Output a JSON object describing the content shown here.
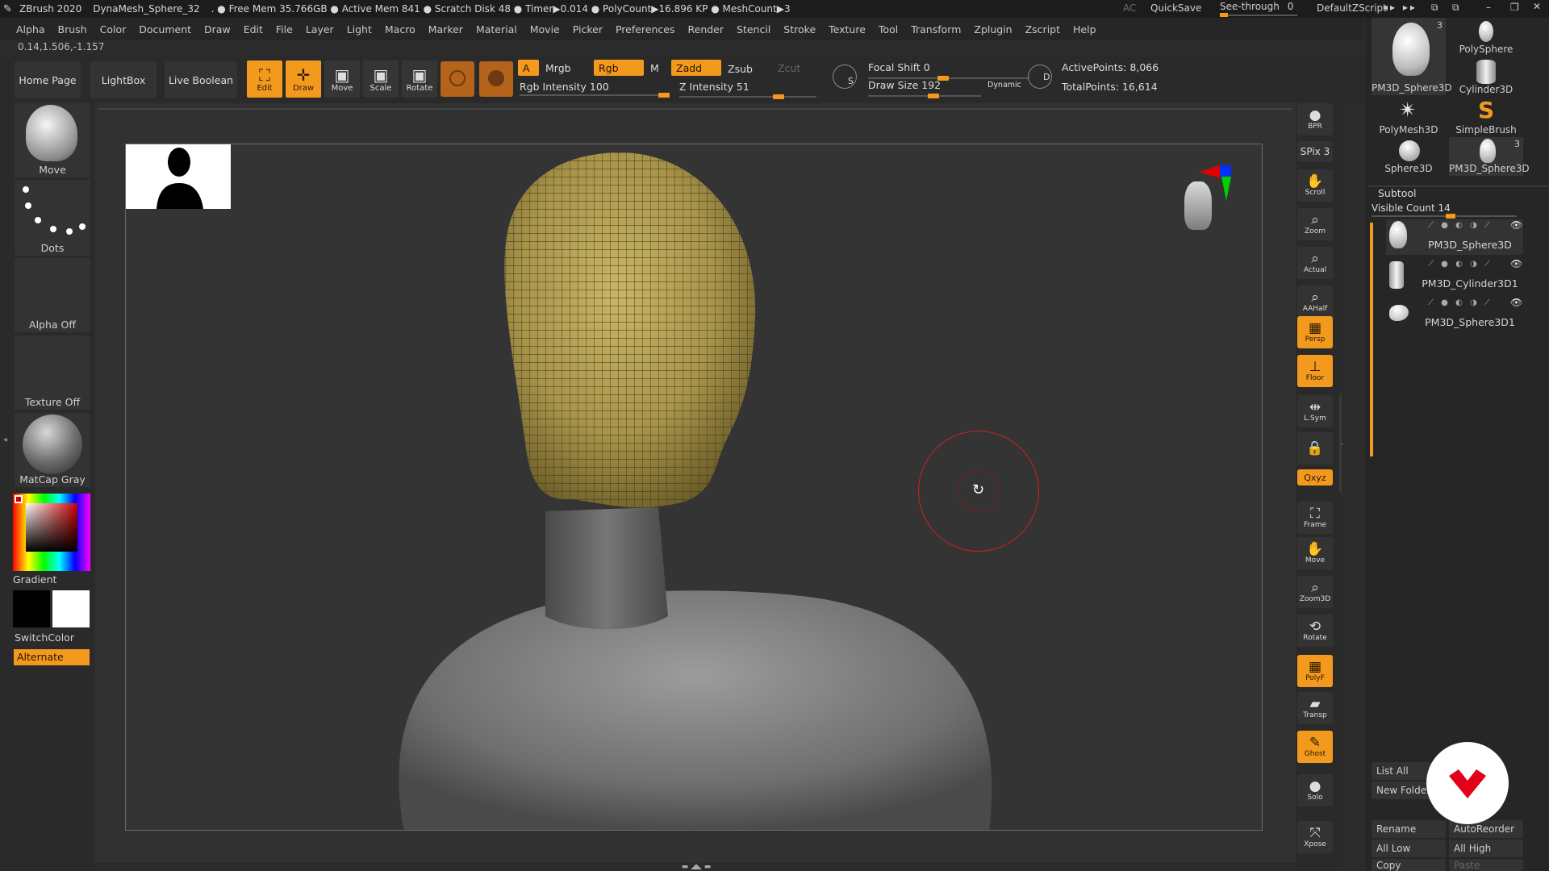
{
  "titlebar": {
    "app": "ZBrush 2020",
    "project": "DynaMesh_Sphere_32",
    "stats": ". ● Free Mem 35.766GB ● Active Mem 841 ● Scratch Disk 48 ● Timer▶0.014 ● PolyCount▶16.896 KP ● MeshCount▶3",
    "ac": "AC",
    "quicksave": "QuickSave",
    "seethrough": "See-through",
    "seethrough_value": "0",
    "script": "DefaultZScript"
  },
  "menu": [
    "Alpha",
    "Brush",
    "Color",
    "Document",
    "Draw",
    "Edit",
    "File",
    "Layer",
    "Light",
    "Macro",
    "Marker",
    "Material",
    "Movie",
    "Picker",
    "Preferences",
    "Render",
    "Stencil",
    "Stroke",
    "Texture",
    "Tool",
    "Transform",
    "Zplugin",
    "Zscript",
    "Help"
  ],
  "coords": "0.14,1.506,-1.157",
  "toptray": {
    "home": "Home Page",
    "lightbox": "LightBox",
    "liveboolean": "Live Boolean",
    "tools": [
      {
        "label": "Edit",
        "icon": "edit-icon",
        "active": true
      },
      {
        "label": "Draw",
        "icon": "draw-icon",
        "active": true
      },
      {
        "label": "Move",
        "icon": "move-icon",
        "active": false
      },
      {
        "label": "Scale",
        "icon": "scale-icon",
        "active": false
      },
      {
        "label": "Rotate",
        "icon": "rotate-icon",
        "active": false
      }
    ],
    "a": "A",
    "mrgb": "Mrgb",
    "rgb": "Rgb",
    "m": "M",
    "zadd": "Zadd",
    "zsub": "Zsub",
    "zcut": "Zcut",
    "rgb_intensity": "Rgb Intensity 100",
    "z_intensity": "Z Intensity 51",
    "focal_shift": "Focal Shift 0",
    "draw_size": "Draw Size 192",
    "dynamic": "Dynamic",
    "s": "S",
    "d": "D",
    "active_points": "ActivePoints: 8,066",
    "total_points": "TotalPoints: 16,614"
  },
  "leftshelf": {
    "brush": "Move",
    "stroke": "Dots",
    "alpha": "Alpha Off",
    "texture": "Texture Off",
    "material": "MatCap Gray",
    "gradient": "Gradient",
    "switchcolor": "SwitchColor",
    "alternate": "Alternate"
  },
  "rightshelf": [
    {
      "label": "BPR",
      "icon": "bpr-icon",
      "on": false
    },
    {
      "label": "SPix 3",
      "icon": "spix-icon",
      "on": false
    },
    {
      "label": "Scroll",
      "icon": "scroll-icon",
      "on": false
    },
    {
      "label": "Zoom",
      "icon": "zoom-icon",
      "on": false
    },
    {
      "label": "Actual",
      "icon": "actual-icon",
      "on": false
    },
    {
      "label": "AAHalf",
      "icon": "aahalf-icon",
      "on": false
    },
    {
      "label": "Persp",
      "icon": "persp-icon",
      "on": true
    },
    {
      "label": "Floor",
      "icon": "floor-icon",
      "on": true
    },
    {
      "label": "L.Sym",
      "icon": "lsym-icon",
      "on": false
    },
    {
      "label": "",
      "icon": "lock-icon",
      "on": false
    },
    {
      "label": "Qxyz",
      "icon": "xyz-icon",
      "on": true
    },
    {
      "label": "Frame",
      "icon": "frame-icon",
      "on": false
    },
    {
      "label": "Move",
      "icon": "move-icon",
      "on": false
    },
    {
      "label": "Zoom3D",
      "icon": "zoom3d-icon",
      "on": false
    },
    {
      "label": "Rotate",
      "icon": "rotate-icon",
      "on": false
    },
    {
      "label": "PolyF",
      "icon": "polyf-icon",
      "on": true
    },
    {
      "label": "Transp",
      "icon": "transp-icon",
      "on": false
    },
    {
      "label": "Ghost",
      "icon": "ghost-icon",
      "on": true
    },
    {
      "label": "Solo",
      "icon": "solo-icon",
      "on": false
    },
    {
      "label": "Xpose",
      "icon": "xpose-icon",
      "on": false
    }
  ],
  "rpanel": {
    "tools": [
      {
        "name": "PM3D_Sphere3D",
        "badge": "3"
      },
      {
        "name": "PolySphere",
        "badge": ""
      },
      {
        "name": "Cylinder3D",
        "badge": ""
      },
      {
        "name": "PolyMesh3D",
        "badge": ""
      },
      {
        "name": "SimpleBrush",
        "badge": ""
      },
      {
        "name": "Sphere3D",
        "badge": ""
      },
      {
        "name": "PM3D_Sphere3D",
        "badge": "3"
      }
    ],
    "subtool_title": "Subtool",
    "visible_count": "Visible Count 14",
    "subtools": [
      "PM3D_Sphere3D",
      "PM3D_Cylinder3D1",
      "PM3D_Sphere3D1"
    ],
    "buttons": {
      "list_all": "List All",
      "new_folder": "New Folder",
      "rename": "Rename",
      "autoreorder": "AutoReorder",
      "all_low": "All Low",
      "all_high": "All High",
      "copy": "Copy",
      "paste": "Paste"
    }
  },
  "colors": {
    "accent": "#f39a1e",
    "mesh": "#b9a550",
    "background": "#343434"
  }
}
